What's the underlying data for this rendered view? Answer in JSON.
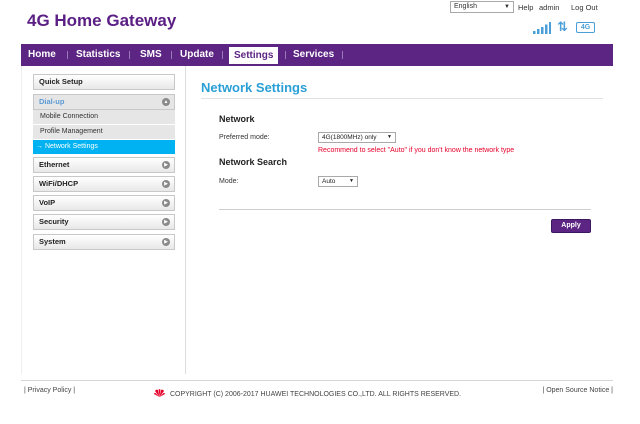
{
  "header": {
    "brand": "4G Home Gateway",
    "language": "English",
    "help_label": "Help",
    "username": "admin",
    "logout_label": "Log Out",
    "network_type": "4G",
    "status_icons": [
      "signal-icon",
      "transfer-icon",
      "network-type-icon"
    ]
  },
  "nav": {
    "items": [
      "Home",
      "Statistics",
      "SMS",
      "Update",
      "Settings",
      "Services"
    ],
    "active": "Settings"
  },
  "sidebar": {
    "groups": [
      {
        "label": "Quick Setup"
      },
      {
        "label": "Dial-up",
        "expanded": true,
        "children": [
          "Mobile Connection",
          "Profile Management",
          "Network Settings"
        ]
      },
      {
        "label": "Ethernet"
      },
      {
        "label": "WiFi/DHCP"
      },
      {
        "label": "VoIP"
      },
      {
        "label": "Security"
      },
      {
        "label": "System"
      }
    ],
    "active_child": "Network Settings"
  },
  "main": {
    "title": "Network Settings",
    "network_heading": "Network",
    "preferred_mode_label": "Preferred mode:",
    "preferred_mode_value": "4G(1800MHz) only",
    "recommend_text": "Recommend to select \"Auto\" if you don't know the network type",
    "search_heading": "Network Search",
    "mode_label": "Mode:",
    "mode_value": "Auto",
    "apply_label": "Apply"
  },
  "footer": {
    "privacy_label": "Privacy Policy",
    "copyright": "COPYRIGHT (C) 2006-2017 HUAWEI TECHNOLOGIES CO.,LTD. ALL RIGHTS RESERVED.",
    "open_source_label": "Open Source Notice"
  },
  "colors": {
    "brand_purple": "#5c2483",
    "title_blue": "#2a9fd6",
    "active_submenu": "#00b2f1",
    "warning_red": "#e4002b"
  }
}
